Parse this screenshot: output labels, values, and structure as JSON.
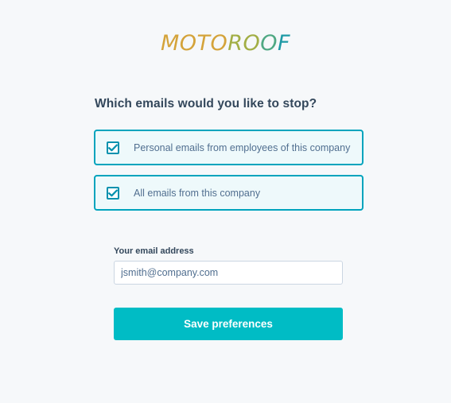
{
  "brand": {
    "logo_part1": "MOTO",
    "logo_part2": "RO",
    "logo_part3": "O",
    "logo_part4": "F",
    "colors": [
      "#d4a33a",
      "#a2ae45",
      "#4fa883",
      "#1e9aa5"
    ]
  },
  "form": {
    "question": "Which emails would you like to stop?",
    "options": [
      {
        "label": "Personal emails from employees of this company",
        "checked": true
      },
      {
        "label": "All emails from this company",
        "checked": true
      }
    ],
    "email_label": "Your email address",
    "email_value": "",
    "email_placeholder": "jsmith@company.com",
    "submit_label": "Save preferences"
  },
  "colors": {
    "accent": "#00bcc5",
    "option_border": "#00a4bd",
    "option_bg": "#eef9fb",
    "text": "#33475b"
  }
}
